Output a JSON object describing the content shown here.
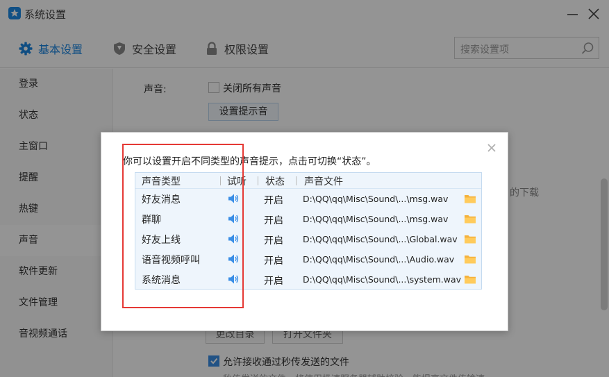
{
  "window": {
    "title": "系统设置"
  },
  "tabs": [
    {
      "label": "基本设置",
      "icon": "gear-icon",
      "active": true
    },
    {
      "label": "安全设置",
      "icon": "shield-icon",
      "active": false
    },
    {
      "label": "权限设置",
      "icon": "lock-icon",
      "active": false
    }
  ],
  "search": {
    "placeholder": "搜索设置项"
  },
  "sidebar": {
    "items": [
      {
        "label": "登录"
      },
      {
        "label": "状态"
      },
      {
        "label": "主窗口"
      },
      {
        "label": "提醒"
      },
      {
        "label": "热键"
      },
      {
        "label": "声音",
        "active": true
      },
      {
        "label": "软件更新"
      },
      {
        "label": "文件管理"
      },
      {
        "label": "音视频通话"
      }
    ]
  },
  "content": {
    "sound_label": "声音:",
    "mute_all_label": "关闭所有声音",
    "mute_all_checked": false,
    "set_tone_button": "设置提示音",
    "partial_right_text": "的下载",
    "change_dir_button": "更改目录",
    "open_folder_button": "打开文件夹",
    "allow_receive_label": "允许接收通过秒传发送的文件",
    "allow_receive_checked": true,
    "allow_receive_hint": "秒传发送的文件，将使用极速服务器辅助校验，能提高文件传输速"
  },
  "dialog": {
    "description": "你可以设置开启不同类型的声音提示，点击可切换“状态”。",
    "columns": {
      "type": "声音类型",
      "listen": "试听",
      "state": "状态",
      "file": "声音文件"
    },
    "rows": [
      {
        "type": "好友消息",
        "state": "开启",
        "file": "D:\\QQ\\qq\\Misc\\Sound\\...\\msg.wav"
      },
      {
        "type": "群聊",
        "state": "开启",
        "file": "D:\\QQ\\qq\\Misc\\Sound\\...\\msg.wav"
      },
      {
        "type": "好友上线",
        "state": "开启",
        "file": "D:\\QQ\\qq\\Misc\\Sound\\...\\Global.wav"
      },
      {
        "type": "语音视频呼叫",
        "state": "开启",
        "file": "D:\\QQ\\qq\\Misc\\Sound\\...\\Audio.wav"
      },
      {
        "type": "系统消息",
        "state": "开启",
        "file": "D:\\QQ\\qq\\Misc\\Sound\\...\\system.wav"
      }
    ]
  },
  "colors": {
    "accent": "#1a86e0",
    "highlight_box": "#e53935",
    "table_bg": "#eef5fc"
  }
}
